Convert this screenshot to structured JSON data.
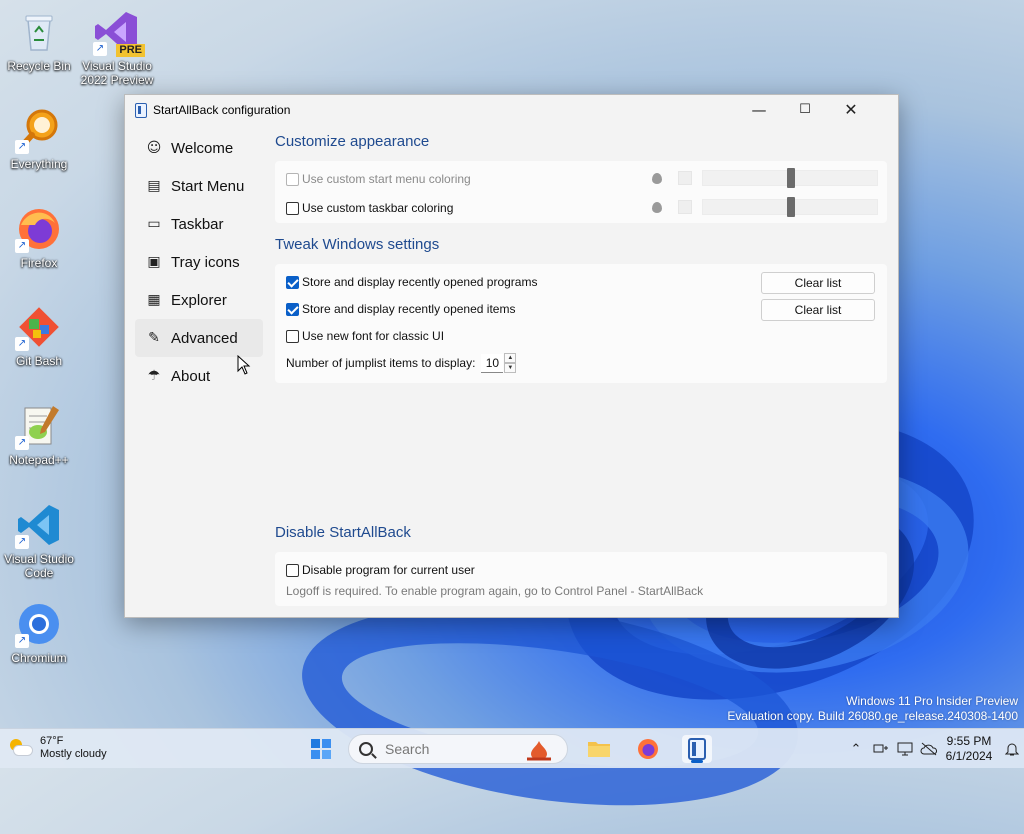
{
  "desktop": {
    "icons": [
      {
        "label": "Recycle Bin",
        "icon": "recycle-bin-icon"
      },
      {
        "label": "Visual Studio 2022 Preview",
        "icon": "visual-studio-icon",
        "badge": "PRE"
      },
      {
        "label": "Everything",
        "icon": "everything-search-icon"
      },
      {
        "label": "Firefox",
        "icon": "firefox-icon"
      },
      {
        "label": "Git Bash",
        "icon": "git-icon"
      },
      {
        "label": "Notepad++",
        "icon": "notepad-plus-icon"
      },
      {
        "label": "Visual Studio Code",
        "icon": "vscode-icon"
      },
      {
        "label": "Chromium",
        "icon": "chromium-icon"
      }
    ],
    "watermark": {
      "line1": "Windows 11 Pro Insider Preview",
      "line2": "Evaluation copy. Build 26080.ge_release.240308-1400"
    }
  },
  "window": {
    "title": "StartAllBack configuration",
    "controls": {
      "minimize": "—",
      "maximize": "☐",
      "close": "✕"
    },
    "sidebar": {
      "items": [
        {
          "label": "Welcome",
          "icon": "smile-icon",
          "glyph": "☺"
        },
        {
          "label": "Start Menu",
          "icon": "start-menu-icon",
          "glyph": "▤"
        },
        {
          "label": "Taskbar",
          "icon": "taskbar-icon",
          "glyph": "▭"
        },
        {
          "label": "Tray icons",
          "icon": "tray-icon",
          "glyph": "▣"
        },
        {
          "label": "Explorer",
          "icon": "folder-icon",
          "glyph": "▦"
        },
        {
          "label": "Advanced",
          "icon": "wrench-icon",
          "glyph": "✎"
        },
        {
          "label": "About",
          "icon": "umbrella-icon",
          "glyph": "☂"
        }
      ],
      "active": "Advanced"
    },
    "appearance": {
      "title": "Customize appearance",
      "start_menu_coloring": {
        "label": "Use custom start menu coloring",
        "checked": false,
        "enabled": false
      },
      "taskbar_coloring": {
        "label": "Use custom taskbar coloring",
        "checked": false,
        "enabled": true
      }
    },
    "tweaks": {
      "title": "Tweak Windows settings",
      "recent_programs": {
        "label": "Store and display recently opened programs",
        "checked": true
      },
      "recent_items": {
        "label": "Store and display recently opened items",
        "checked": true
      },
      "new_font": {
        "label": "Use new font for classic UI",
        "checked": false
      },
      "clear_list_label": "Clear list",
      "jumplist_label": "Number of jumplist items to display:",
      "jumplist_value": "10",
      "spin_up": "▲",
      "spin_down": "▼"
    },
    "disable": {
      "title": "Disable StartAllBack",
      "checkbox_label": "Disable program for current user",
      "note": "Logoff is required. To enable program again, go to Control Panel - StartAllBack"
    }
  },
  "taskbar": {
    "weather": {
      "temp": "67°F",
      "condition": "Mostly cloudy"
    },
    "search_placeholder": "Search",
    "clock": {
      "time": "9:55 PM",
      "date": "6/1/2024"
    },
    "tray_glyphs": {
      "chevron": "⌃",
      "bell": "♫"
    }
  },
  "colors": {
    "accent": "#0a5fc8",
    "section_title": "#1f4a8f"
  }
}
